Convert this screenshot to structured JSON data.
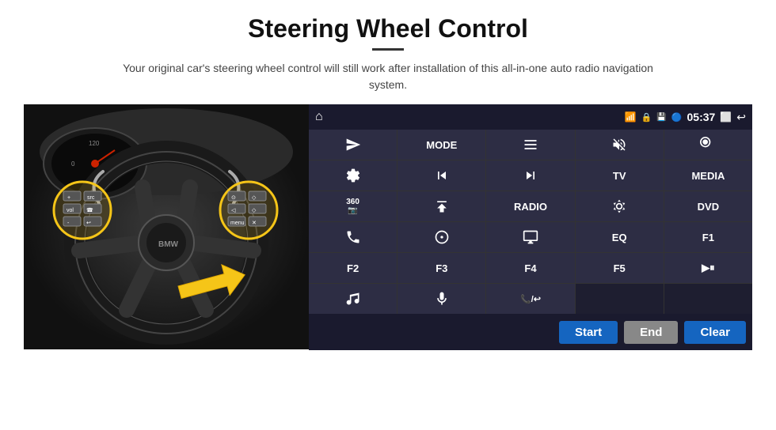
{
  "header": {
    "title": "Steering Wheel Control",
    "subtitle": "Your original car's steering wheel control will still work after installation of this all-in-one auto radio navigation system."
  },
  "status_bar": {
    "home_icon": "⌂",
    "wifi_icon": "wifi",
    "lock_icon": "🔒",
    "sd_icon": "sd",
    "bt_icon": "bt",
    "time": "05:37",
    "window_icon": "win",
    "back_icon": "←"
  },
  "buttons": [
    {
      "label": "▷",
      "icon": "send",
      "row": 1,
      "col": 1
    },
    {
      "label": "MODE",
      "row": 1,
      "col": 2
    },
    {
      "label": "☰",
      "icon": "list",
      "row": 1,
      "col": 3
    },
    {
      "label": "🔇",
      "icon": "mute",
      "row": 1,
      "col": 4
    },
    {
      "label": "⊞",
      "icon": "apps",
      "row": 1,
      "col": 5
    },
    {
      "label": "⊙",
      "icon": "settings",
      "row": 2,
      "col": 1
    },
    {
      "label": "⏮",
      "icon": "prev",
      "row": 2,
      "col": 2
    },
    {
      "label": "⏭",
      "icon": "next",
      "row": 2,
      "col": 3
    },
    {
      "label": "TV",
      "row": 2,
      "col": 4
    },
    {
      "label": "MEDIA",
      "row": 2,
      "col": 5
    },
    {
      "label": "360",
      "icon": "360cam",
      "row": 3,
      "col": 1
    },
    {
      "label": "▲",
      "icon": "eject",
      "row": 3,
      "col": 2
    },
    {
      "label": "RADIO",
      "row": 3,
      "col": 3
    },
    {
      "label": "☀",
      "icon": "brightness",
      "row": 3,
      "col": 4
    },
    {
      "label": "DVD",
      "row": 3,
      "col": 5
    },
    {
      "label": "☎",
      "icon": "phone",
      "row": 4,
      "col": 1
    },
    {
      "label": "◎",
      "icon": "navi",
      "row": 4,
      "col": 2
    },
    {
      "label": "▬",
      "icon": "display",
      "row": 4,
      "col": 3
    },
    {
      "label": "EQ",
      "row": 4,
      "col": 4
    },
    {
      "label": "F1",
      "row": 4,
      "col": 5
    },
    {
      "label": "F2",
      "row": 5,
      "col": 1
    },
    {
      "label": "F3",
      "row": 5,
      "col": 2
    },
    {
      "label": "F4",
      "row": 5,
      "col": 3
    },
    {
      "label": "F5",
      "row": 5,
      "col": 4
    },
    {
      "label": "▶⏸",
      "icon": "playpause",
      "row": 5,
      "col": 5
    },
    {
      "label": "♪",
      "icon": "music",
      "row": 6,
      "col": 1
    },
    {
      "label": "🎤",
      "icon": "mic",
      "row": 6,
      "col": 2
    },
    {
      "label": "📞",
      "icon": "hangup",
      "row": 6,
      "col": 3
    },
    {
      "label": "",
      "row": 6,
      "col": 4
    },
    {
      "label": "",
      "row": 6,
      "col": 5
    }
  ],
  "action_buttons": {
    "start": "Start",
    "end": "End",
    "clear": "Clear"
  }
}
